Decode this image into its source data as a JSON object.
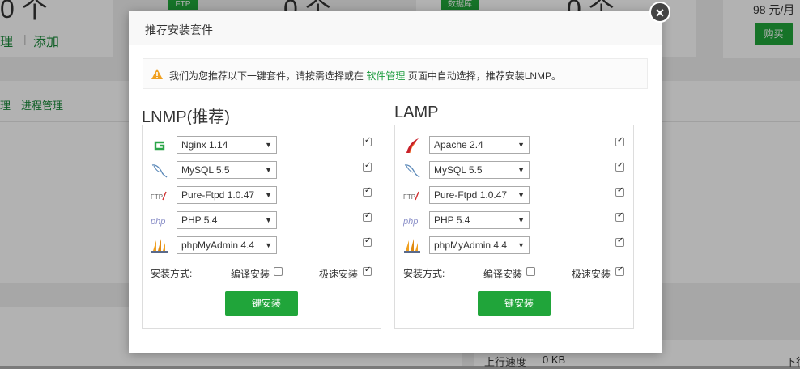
{
  "background": {
    "top_left_digit": "0 个",
    "top_mid1_digit": "0 个",
    "top_mid2_digit": "0 个",
    "ftp_tag": "FTP",
    "db_tag": "数据库",
    "manage_link": "理",
    "add_link": "添加",
    "price": "98 元/月",
    "buy_button": "购买",
    "tab_1": "理",
    "tab_process": "进程管理",
    "upload_speed_label": "上行速度",
    "upload_speed_value": "0 KB",
    "download_label": "下行"
  },
  "dialog": {
    "title": "推荐安装套件",
    "close": "×",
    "notice_before": "我们为您推荐以下一键套件，请按需选择或在 ",
    "notice_link": "软件管理",
    "notice_after": " 页面中自动选择，推荐安装LNMP。"
  },
  "lnmp": {
    "title": "LNMP(推荐)",
    "items": [
      {
        "icon": "nginx-icon",
        "value": "Nginx 1.14",
        "checked": true
      },
      {
        "icon": "mysql-icon",
        "value": "MySQL 5.5",
        "checked": true
      },
      {
        "icon": "ftp-icon",
        "value": "Pure-Ftpd 1.0.47",
        "checked": true
      },
      {
        "icon": "php-icon",
        "value": "PHP 5.4",
        "checked": true
      },
      {
        "icon": "phpmyadmin-icon",
        "value": "phpMyAdmin 4.4",
        "checked": true
      }
    ],
    "install_method_label": "安装方式:",
    "compile_label": "编译安装",
    "fast_label": "极速安装",
    "install_button": "一键安装"
  },
  "lamp": {
    "title": "LAMP",
    "items": [
      {
        "icon": "apache-icon",
        "value": "Apache 2.4",
        "checked": true
      },
      {
        "icon": "mysql-icon",
        "value": "MySQL 5.5",
        "checked": true
      },
      {
        "icon": "ftp-icon",
        "value": "Pure-Ftpd 1.0.47",
        "checked": true
      },
      {
        "icon": "php-icon",
        "value": "PHP 5.4",
        "checked": true
      },
      {
        "icon": "phpmyadmin-icon",
        "value": "phpMyAdmin 4.4",
        "checked": true
      }
    ],
    "install_method_label": "安装方式:",
    "compile_label": "编译安装",
    "fast_label": "极速安装",
    "install_button": "一键安装"
  },
  "colors": {
    "accent": "#20a53a",
    "link": "#1a9b3c",
    "warning": "#f0a020"
  }
}
